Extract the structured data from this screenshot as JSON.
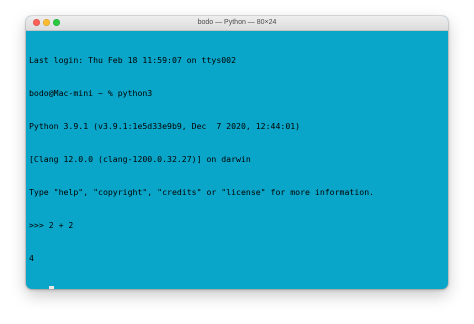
{
  "window": {
    "title": "bodo — Python — 80×24",
    "terminal_bg": "#0aa6c9",
    "traffic_lights": {
      "close": "#fe5f57",
      "minimize": "#febc2e",
      "maximize": "#28c840"
    }
  },
  "terminal": {
    "lines": [
      "Last login: Thu Feb 18 11:59:07 on ttys002",
      "bodo@Mac-mini ~ % python3",
      "Python 3.9.1 (v3.9.1:1e5d33e9b9, Dec  7 2020, 12:44:01)",
      "[Clang 12.0.0 (clang-1200.0.32.27)] on darwin",
      "Type \"help\", \"copyright\", \"credits\" or \"license\" for more information.",
      ">>> 2 + 2",
      "4"
    ],
    "prompt": ">>> ",
    "cursor_color": "#eaeaea"
  }
}
